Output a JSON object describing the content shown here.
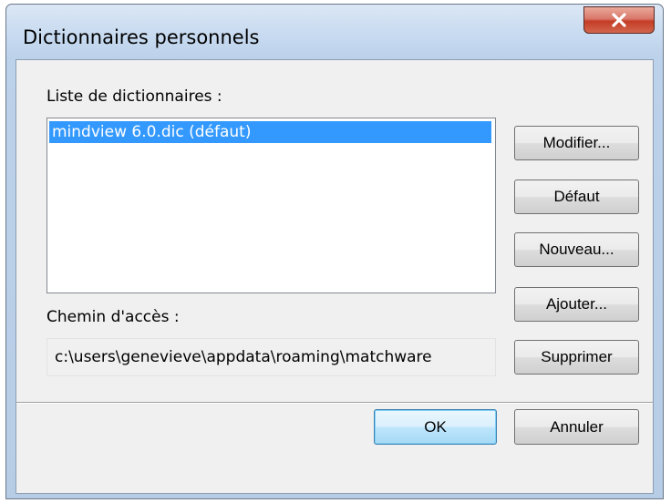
{
  "window": {
    "title": "Dictionnaires personnels",
    "close_glyph": "X"
  },
  "list_label": "Liste de dictionnaires :",
  "list_items": [
    "mindview 6.0.dic (défaut)"
  ],
  "path_label": "Chemin d'accès :",
  "path_value": "c:\\users\\genevieve\\appdata\\roaming\\matchware",
  "buttons": {
    "modify": "Modifier...",
    "default": "Défaut",
    "new": "Nouveau...",
    "add": "Ajouter...",
    "delete": "Supprimer",
    "ok": "OK",
    "cancel": "Annuler"
  },
  "colors": {
    "selection": "#3399ff",
    "close_button": "#c43c26",
    "title_bar": "#c4d8ef"
  }
}
